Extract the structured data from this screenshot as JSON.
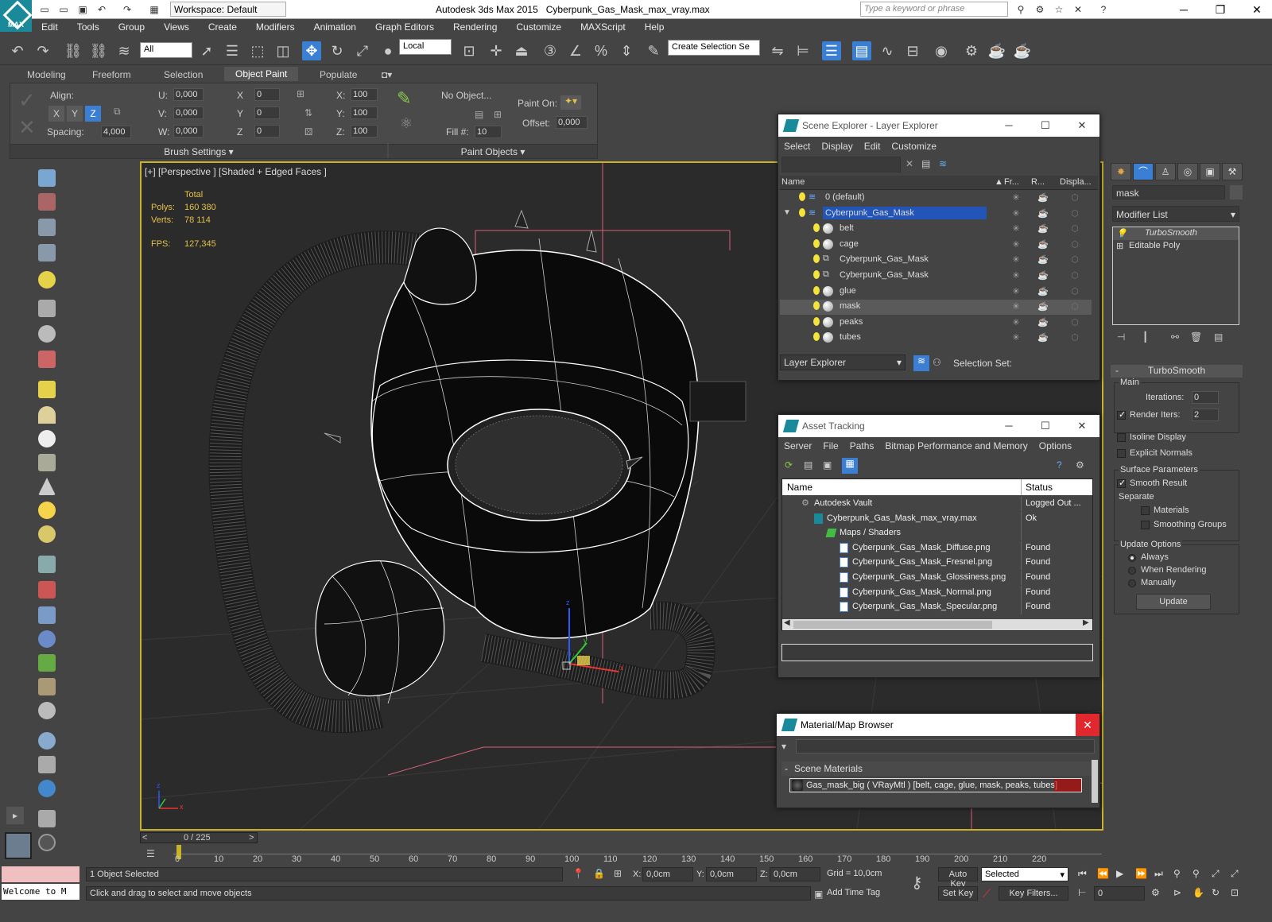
{
  "window": {
    "app": "Autodesk 3ds Max  2015",
    "file": "Cyberpunk_Gas_Mask_max_vray.max",
    "logo": "MAX",
    "workspace": "Workspace: Default",
    "search_placeholder": "Type a keyword or phrase"
  },
  "menu": [
    "Edit",
    "Tools",
    "Group",
    "Views",
    "Create",
    "Modifiers",
    "Animation",
    "Graph Editors",
    "Rendering",
    "Customize",
    "MAXScript",
    "Help"
  ],
  "toolbar": {
    "filter": "All",
    "coord": "Local",
    "selection_set": "Create Selection Se"
  },
  "ribbon": {
    "tabs": [
      "Modeling",
      "Freeform",
      "Selection",
      "Object Paint",
      "Populate"
    ],
    "active_tab": "Object Paint",
    "align_label": "Align:",
    "axis": [
      "X",
      "Y",
      "Z"
    ],
    "spacing_label": "Spacing:",
    "spacing_value": "4,000",
    "u_label": "U:",
    "v_label": "V:",
    "w_label": "W:",
    "u_value": "0,000",
    "v_value": "0,000",
    "w_value": "0,000",
    "rx_label": "X",
    "ry_label": "Y",
    "rz_label": "Z",
    "rx_value": "0",
    "ry_value": "0",
    "rz_value": "0",
    "sx_label": "X:",
    "sy_label": "Y:",
    "sz_label": "Z:",
    "sx_value": "100",
    "sy_value": "100",
    "sz_value": "100",
    "no_object": "No Object...",
    "fill_label": "Fill #:",
    "fill_value": "10",
    "paint_on": "Paint On:",
    "offset_label": "Offset:",
    "offset_value": "0,000",
    "brush_settings": "Brush Settings",
    "paint_objects": "Paint Objects"
  },
  "viewport": {
    "label": "[+] [Perspective ] [Shaded + Edged Faces ]",
    "total_label": "Total",
    "polys_label": "Polys:",
    "polys_value": "160 380",
    "verts_label": "Verts:",
    "verts_value": "78 114",
    "fps_label": "FPS:",
    "fps_value": "127,345",
    "gizmo_x": "x",
    "gizmo_y": "y",
    "gizmo_z": "z",
    "corner_x": "x",
    "corner_z": "z"
  },
  "scene_explorer": {
    "title": "Scene Explorer - Layer Explorer",
    "menu": [
      "Select",
      "Display",
      "Edit",
      "Customize"
    ],
    "columns": [
      "Name",
      "Fr...",
      "R...",
      "Displa..."
    ],
    "rows": [
      {
        "name": "0 (default)",
        "indent": 0,
        "type": "layer"
      },
      {
        "name": "Cyberpunk_Gas_Mask",
        "indent": 0,
        "type": "layer",
        "selected": true
      },
      {
        "name": "belt",
        "indent": 1,
        "type": "object"
      },
      {
        "name": "cage",
        "indent": 1,
        "type": "object"
      },
      {
        "name": "Cyberpunk_Gas_Mask",
        "indent": 1,
        "type": "group"
      },
      {
        "name": "Cyberpunk_Gas_Mask",
        "indent": 1,
        "type": "group"
      },
      {
        "name": "glue",
        "indent": 1,
        "type": "object"
      },
      {
        "name": "mask",
        "indent": 1,
        "type": "object",
        "highlight": true
      },
      {
        "name": "peaks",
        "indent": 1,
        "type": "object"
      },
      {
        "name": "tubes",
        "indent": 1,
        "type": "object"
      }
    ],
    "footer_dropdown": "Layer Explorer",
    "selection_set": "Selection Set:"
  },
  "asset_tracking": {
    "title": "Asset Tracking",
    "menu": [
      "Server",
      "File",
      "Paths",
      "Bitmap Performance and Memory",
      "Options"
    ],
    "columns": [
      "Name",
      "Status"
    ],
    "rows": [
      {
        "name": "Autodesk Vault",
        "status": "Logged Out ...",
        "indent": 0
      },
      {
        "name": "Cyberpunk_Gas_Mask_max_vray.max",
        "status": "Ok",
        "indent": 1
      },
      {
        "name": "Maps / Shaders",
        "status": "",
        "indent": 2
      },
      {
        "name": "Cyberpunk_Gas_Mask_Diffuse.png",
        "status": "Found",
        "indent": 3
      },
      {
        "name": "Cyberpunk_Gas_Mask_Fresnel.png",
        "status": "Found",
        "indent": 3
      },
      {
        "name": "Cyberpunk_Gas_Mask_Glossiness.png",
        "status": "Found",
        "indent": 3
      },
      {
        "name": "Cyberpunk_Gas_Mask_Normal.png",
        "status": "Found",
        "indent": 3
      },
      {
        "name": "Cyberpunk_Gas_Mask_Specular.png",
        "status": "Found",
        "indent": 3
      }
    ]
  },
  "material_browser": {
    "title": "Material/Map Browser",
    "section": "Scene Materials",
    "item": "Gas_mask_big  ( VRayMtl ) [belt, cage, glue, mask, peaks, tubes]"
  },
  "command_panel": {
    "object_name": "mask",
    "modifier_list": "Modifier List",
    "stack": [
      "TurboSmooth",
      "Editable Poly"
    ],
    "rollout": "TurboSmooth",
    "main": "Main",
    "iterations_label": "Iterations:",
    "iterations_value": "0",
    "render_iters_label": "Render Iters:",
    "render_iters_value": "2",
    "isoline": "Isoline Display",
    "explicit": "Explicit Normals",
    "surface": "Surface Parameters",
    "smooth_result": "Smooth Result",
    "separate": "Separate",
    "materials": "Materials",
    "smoothing_groups": "Smoothing Groups",
    "update_options": "Update Options",
    "always": "Always",
    "when_rendering": "When Rendering",
    "manually": "Manually",
    "update": "Update"
  },
  "timeline": {
    "frame": "0 / 225",
    "ticks": [
      "0",
      "10",
      "20",
      "30",
      "40",
      "50",
      "60",
      "70",
      "80",
      "90",
      "100",
      "110",
      "120",
      "130",
      "140",
      "150",
      "160",
      "170",
      "180",
      "190",
      "200",
      "210",
      "220"
    ]
  },
  "status": {
    "welcome": "Welcome to M",
    "selected": "1 Object Selected",
    "prompt": "Click and drag to select and move objects",
    "x_label": "X:",
    "x_value": "0,0cm",
    "y_label": "Y:",
    "y_value": "0,0cm",
    "z_label": "Z:",
    "z_value": "0,0cm",
    "grid": "Grid = 10,0cm",
    "auto_key": "Auto Key",
    "set_key": "Set Key",
    "selected_dd": "Selected",
    "key_filters": "Key Filters...",
    "add_time_tag": "Add Time Tag",
    "frame_value": "0"
  },
  "colors": {
    "accent": "#1a8a9a",
    "viewport_border": "#c8b227",
    "selection": "#2355b8",
    "stat": "#e5c14a"
  }
}
